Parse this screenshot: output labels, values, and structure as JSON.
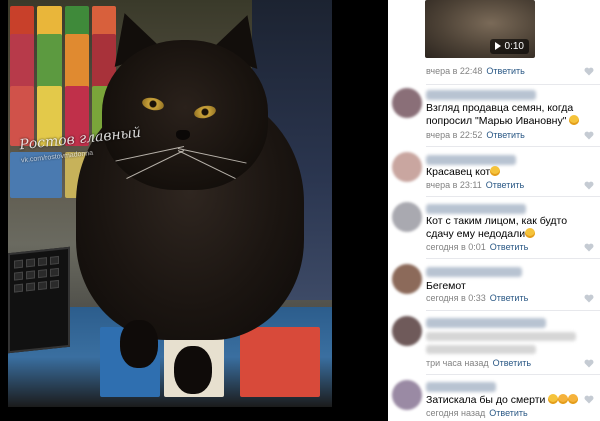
{
  "photo": {
    "watermark_title": "Ростов главный",
    "watermark_sub": "vk.com/rostovmadonna"
  },
  "video": {
    "duration": "0:10"
  },
  "comments": [
    {
      "text": "",
      "time": "вчера в 22:48",
      "reply": "Ответить"
    },
    {
      "text": "Взгляд продавца семян, когда попросил \"Марью Ивановну\"",
      "time": "вчера в 22:52",
      "reply": "Ответить"
    },
    {
      "text": "Красавец кот",
      "time": "вчера в 23:11",
      "reply": "Ответить"
    },
    {
      "text": "Кот с таким лицом, как будто сдачу ему недодали",
      "time": "сегодня в 0:01",
      "reply": "Ответить"
    },
    {
      "text": "Бегемот",
      "time": "сегодня в 0:33",
      "reply": "Ответить"
    },
    {
      "text": "",
      "time": "три часа назад",
      "reply": "Ответить"
    },
    {
      "text": "Затискала бы до смерти",
      "time": "сегодня назад",
      "reply": "Ответить"
    }
  ],
  "colors": {
    "link": "#2a5885",
    "meta": "#828282",
    "divider": "#e7e8ec"
  }
}
